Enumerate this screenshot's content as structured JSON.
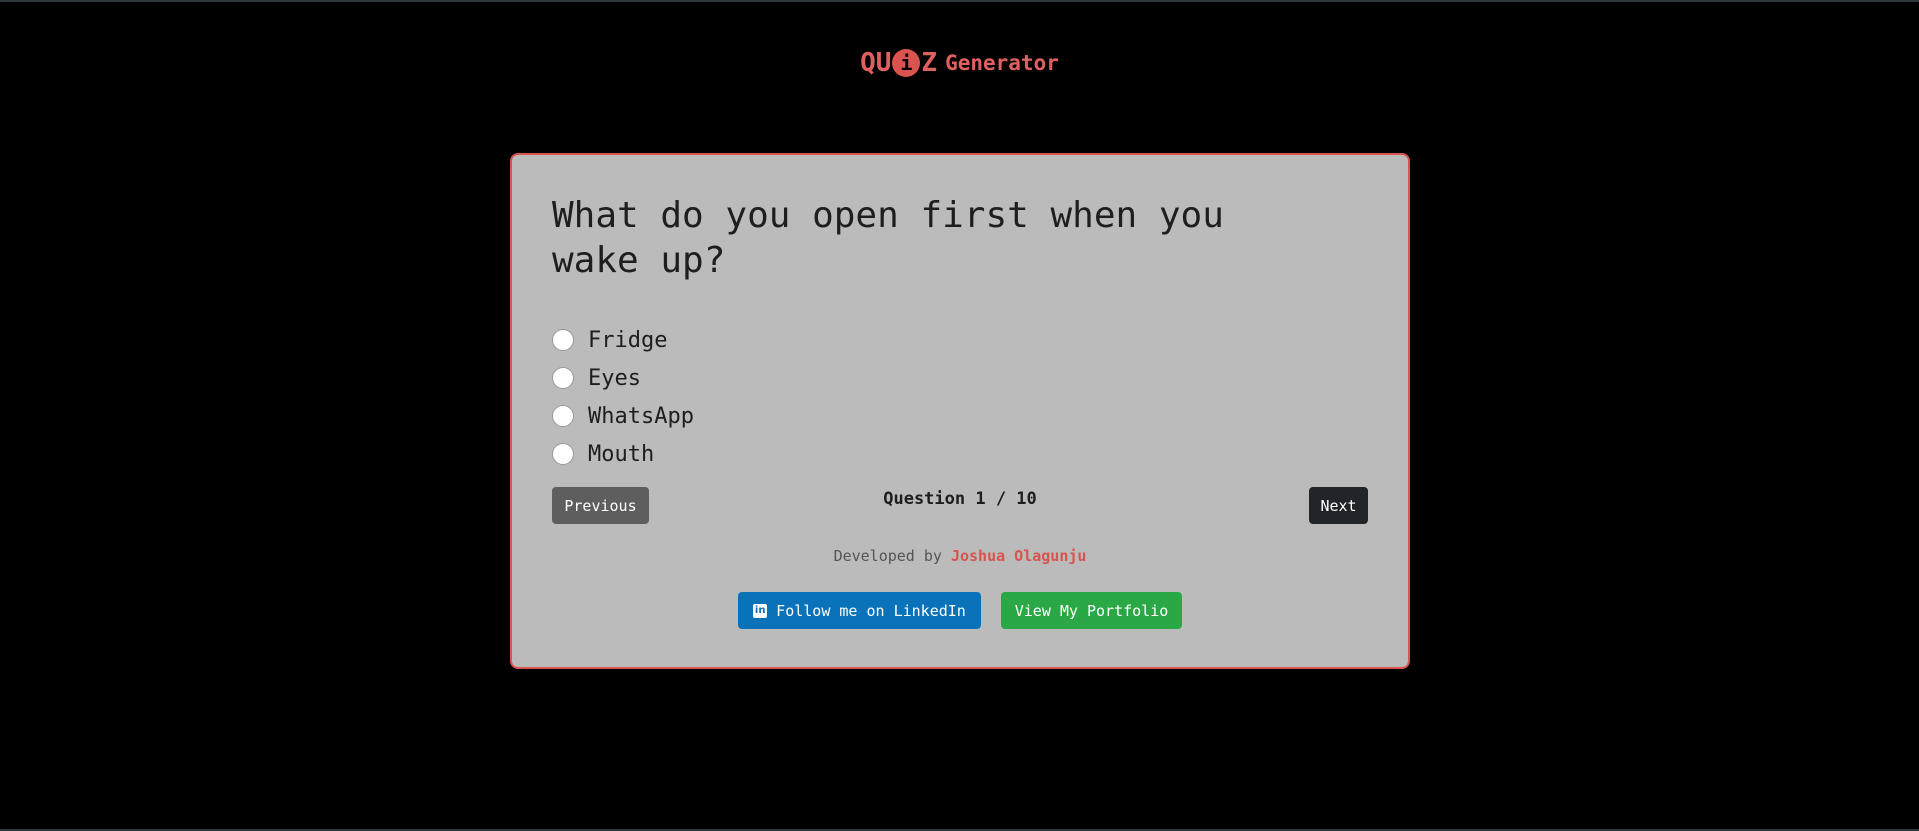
{
  "header": {
    "logo_prefix": "QU",
    "logo_dot": "i",
    "logo_suffix": "Z",
    "logo_word": "Generator"
  },
  "quiz": {
    "question": "What do you open first when you wake up?",
    "options": [
      "Fridge",
      "Eyes",
      "WhatsApp",
      "Mouth"
    ],
    "counter": "Question 1 / 10",
    "previous_label": "Previous",
    "next_label": "Next"
  },
  "footer": {
    "developed_by": "Developed by",
    "author": "Joshua Olagunju",
    "linkedin_icon": "in",
    "linkedin_label": "Follow me on LinkedIn",
    "portfolio_label": "View My Portfolio"
  },
  "colors": {
    "accent": "#d9534f",
    "card_bg": "#bbbbbb",
    "linkedin": "#0a72b9",
    "portfolio": "#2aa845"
  }
}
